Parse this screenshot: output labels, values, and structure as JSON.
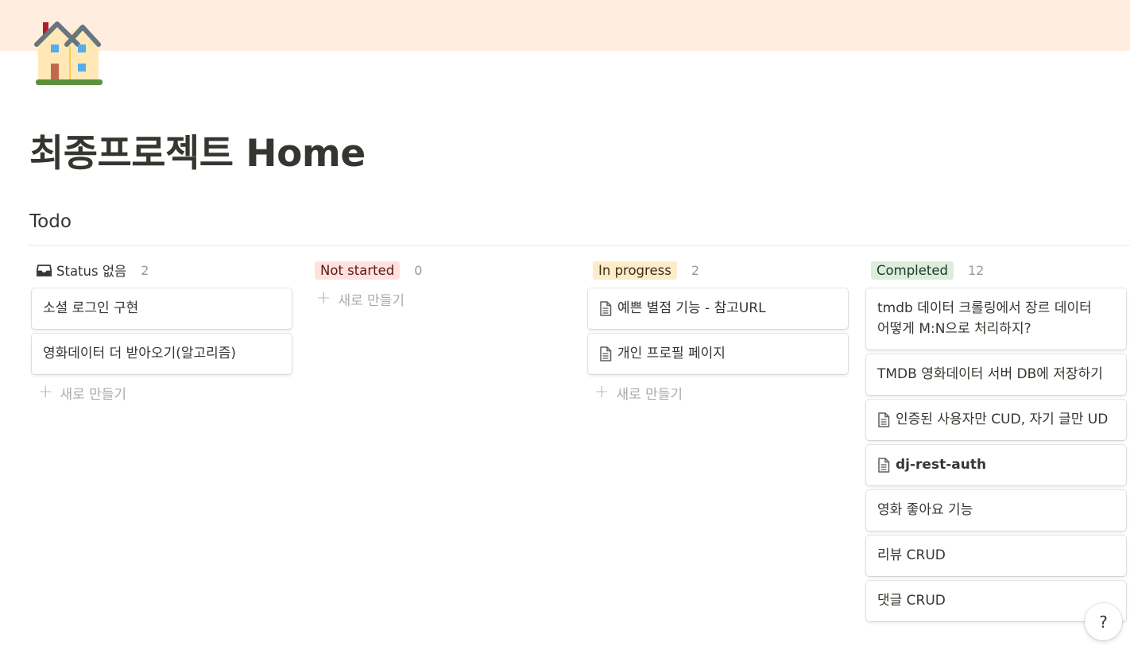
{
  "page": {
    "title": "최종프로젝트 Home",
    "cover_color": "#ffede0",
    "icon": "house-icon"
  },
  "database": {
    "title": "Todo",
    "new_label": "새로 만들기",
    "columns": [
      {
        "status": "Status 없음",
        "count": "2",
        "pill_bg": null,
        "cards": [
          {
            "text": "소셜 로그인 구현",
            "doc_icon": false
          },
          {
            "text": "영화데이터 더 받아오기(알고리즘)",
            "doc_icon": false
          }
        ]
      },
      {
        "status": "Not started",
        "count": "0",
        "pill_bg": "#ffe2dd",
        "cards": []
      },
      {
        "status": "In progress",
        "count": "2",
        "pill_bg": "#fdecc8",
        "cards": [
          {
            "text": "예쁜 별점 기능 - 참고URL",
            "doc_icon": true
          },
          {
            "text": "개인 프로필 페이지",
            "doc_icon": true
          }
        ]
      },
      {
        "status": "Completed",
        "count": "12",
        "pill_bg": "#dbeddb",
        "cards": [
          {
            "text": "tmdb 데이터 크롤링에서 장르 데이터 어떻게 M:N으로 처리하지?",
            "doc_icon": false
          },
          {
            "text": "TMDB 영화데이터 서버 DB에 저장하기",
            "doc_icon": false
          },
          {
            "text": "인증된 사용자만 CUD, 자기 글만 UD",
            "doc_icon": true
          },
          {
            "text": "dj-rest-auth",
            "doc_icon": true
          },
          {
            "text": "영화 좋아요 기능",
            "doc_icon": false
          },
          {
            "text": "리뷰 CRUD",
            "doc_icon": false
          },
          {
            "text": "댓글 CRUD",
            "doc_icon": false
          }
        ]
      }
    ]
  },
  "help": {
    "label": "?"
  }
}
